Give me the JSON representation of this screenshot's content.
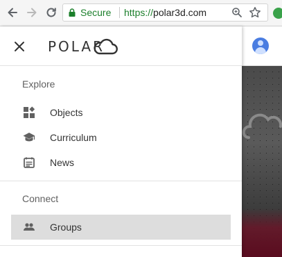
{
  "browser": {
    "secure_label": "Secure",
    "url_protocol": "https://",
    "url_host": "polar3d.com",
    "back_icon": "back-arrow-icon",
    "forward_icon": "forward-arrow-icon",
    "reload_icon": "reload-icon"
  },
  "drawer": {
    "logo_text": "POLAR",
    "sections": [
      {
        "title": "Explore",
        "items": [
          {
            "label": "Objects",
            "icon": "objects-icon"
          },
          {
            "label": "Curriculum",
            "icon": "graduation-cap-icon"
          },
          {
            "label": "News",
            "icon": "news-icon"
          }
        ]
      },
      {
        "title": "Connect",
        "items": [
          {
            "label": "Groups",
            "icon": "groups-icon",
            "selected": true
          }
        ]
      }
    ]
  },
  "colors": {
    "secure_green": "#1b7f2b",
    "selected_bg": "#dddddd",
    "icon_gray": "#616161",
    "avatar_blue": "#4a7de1"
  }
}
